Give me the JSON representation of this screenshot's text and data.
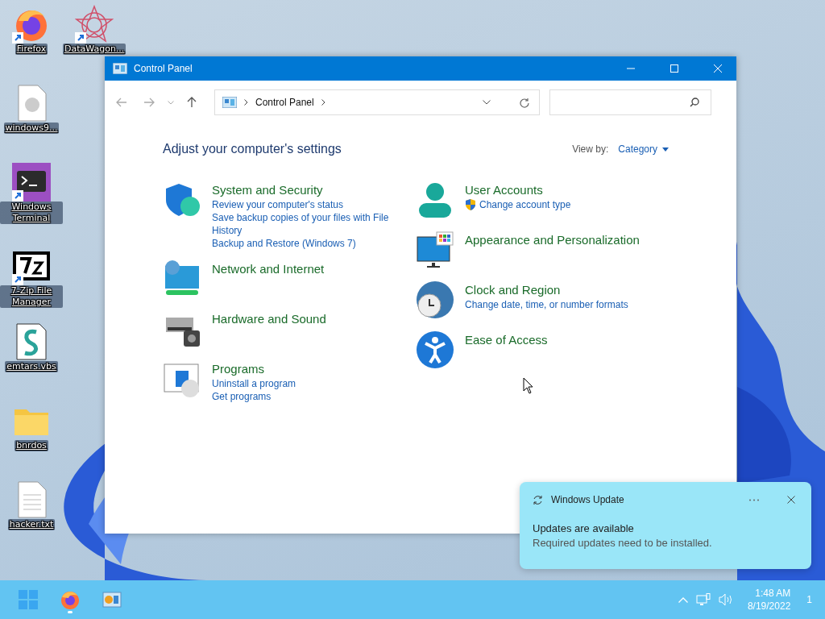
{
  "desktop_icons": [
    {
      "label": "Firefox",
      "kind": "firefox",
      "shortcut": true
    },
    {
      "label": "DataWagon...",
      "kind": "star",
      "shortcut": true
    },
    {
      "label": "windows9...",
      "kind": "disc",
      "shortcut": false
    },
    {
      "label": "Windows Terminal",
      "kind": "terminal",
      "shortcut": true
    },
    {
      "label": "7-Zip File Manager",
      "kind": "zip",
      "shortcut": true
    },
    {
      "label": "emtars.vbs",
      "kind": "script",
      "shortcut": false
    },
    {
      "label": "bnrdos",
      "kind": "folder",
      "shortcut": false
    },
    {
      "label": "hacker.txt",
      "kind": "text",
      "shortcut": false
    }
  ],
  "window": {
    "title": "Control Panel",
    "address": {
      "breadcrumb": "Control Panel"
    },
    "heading": "Adjust your computer's settings",
    "view_by": {
      "label": "View by:",
      "value": "Category"
    },
    "categories": [
      {
        "title": "System and Security",
        "links": [
          {
            "text": "Review your computer's status",
            "shield": false
          },
          {
            "text": "Save backup copies of your files with File History",
            "shield": false
          },
          {
            "text": "Backup and Restore (Windows 7)",
            "shield": false
          }
        ]
      },
      {
        "title": "Network and Internet"
      },
      {
        "title": "Hardware and Sound"
      },
      {
        "title": "Programs",
        "links": [
          {
            "text": "Uninstall a program",
            "shield": false
          },
          {
            "text": "Get programs",
            "shield": false
          }
        ]
      },
      {
        "title": "User Accounts",
        "links": [
          {
            "text": "Change account type",
            "shield": true
          }
        ]
      },
      {
        "title": "Appearance and Personalization"
      },
      {
        "title": "Clock and Region",
        "links": [
          {
            "text": "Change date, time, or number formats",
            "shield": false
          }
        ]
      },
      {
        "title": "Ease of Access"
      }
    ]
  },
  "notification": {
    "app": "Windows Update",
    "title": "Updates are available",
    "body": "Required updates need to be installed."
  },
  "taskbar": {
    "apps": [
      {
        "kind": "start",
        "running": false
      },
      {
        "kind": "firefox",
        "running": true
      },
      {
        "kind": "control-panel",
        "running": false
      }
    ],
    "time": "1:48 AM",
    "date": "8/19/2022",
    "notification_count": "1"
  }
}
